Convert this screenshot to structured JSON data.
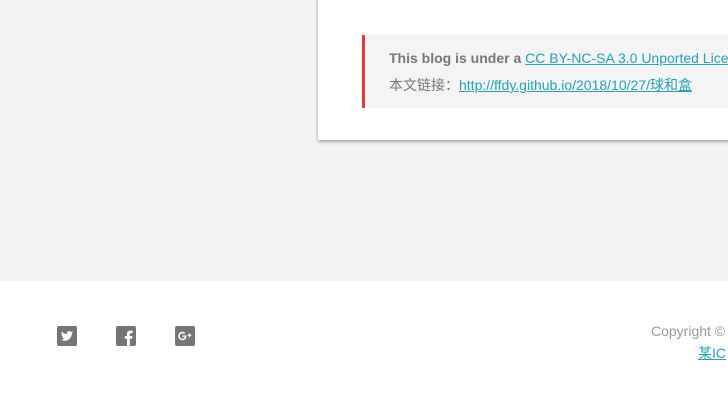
{
  "license": {
    "bold_text": "This blog is under a",
    "license_link_text": "CC BY-NC-SA 3.0 Unported Lice",
    "permalink_label": "本文链接：",
    "permalink_url": "http://ffdy.github.io/2018/10/27/球和盒"
  },
  "footer": {
    "social_icons": [
      "twitter-icon",
      "facebook-icon",
      "google-plus-icon"
    ],
    "copyright_text": "Copyright ©",
    "site_link_text": "某IC"
  },
  "colors": {
    "accent": "#26a1b6",
    "quote_border": "#e53935",
    "icon_gray": "#757575",
    "background": "#f3f3f3"
  }
}
